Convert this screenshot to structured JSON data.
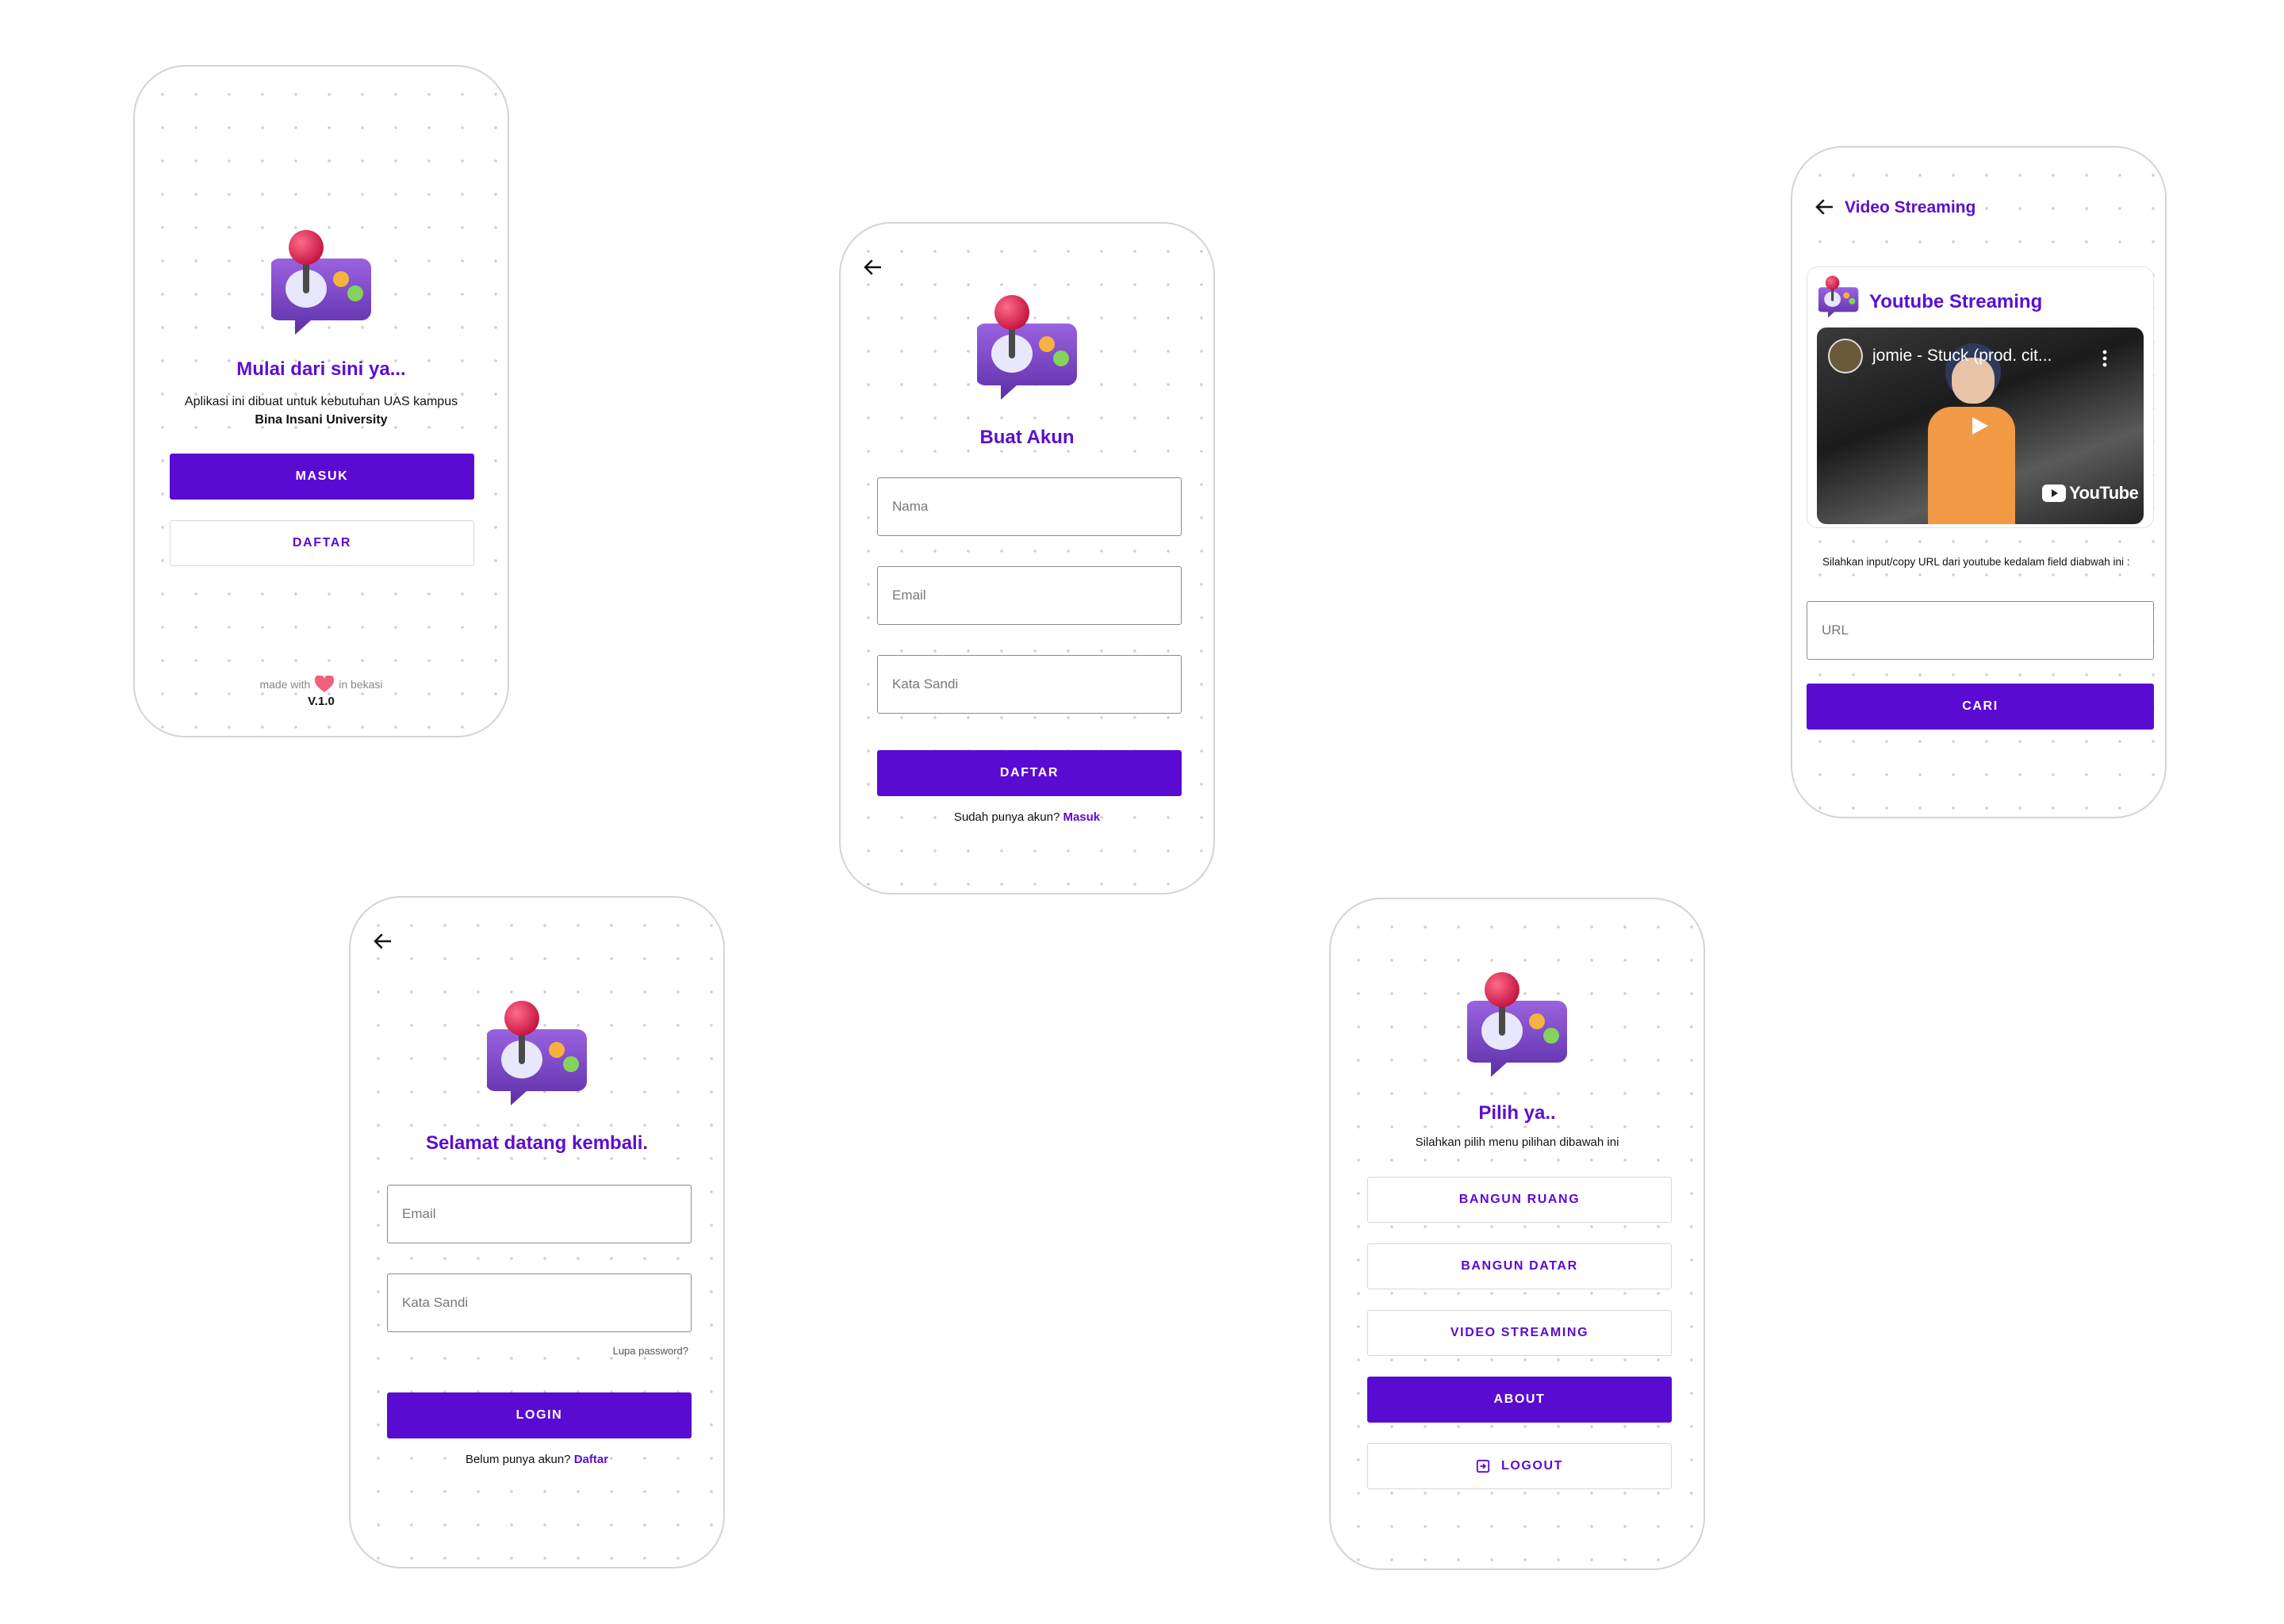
{
  "welcome": {
    "title": "Mulai dari sini ya...",
    "desc_line1": "Aplikasi ini dibuat untuk kebutuhan UAS kampus",
    "desc_line2": "Bina Insani University",
    "masuk_label": "MASUK",
    "daftar_label": "DAFTAR",
    "footer_made": "made with",
    "footer_in": "in bekasi",
    "version": "V.1.0"
  },
  "register": {
    "title": "Buat Akun",
    "name_placeholder": "Nama",
    "email_placeholder": "Email",
    "password_placeholder": "Kata Sandi",
    "submit_label": "DAFTAR",
    "have_account": "Sudah punya akun?",
    "login_link": "Masuk"
  },
  "video": {
    "header_title": "Video Streaming",
    "card_title": "Youtube Streaming",
    "video_title": "jomie - Stuck (prod. cit...",
    "youtube_brand": "YouTube",
    "instruction": "Silahkan input/copy URL dari youtube kedalam field diabwah ini :",
    "url_placeholder": "URL",
    "search_label": "CARI"
  },
  "login": {
    "title": "Selamat datang kembali.",
    "email_placeholder": "Email",
    "password_placeholder": "Kata Sandi",
    "forgot": "Lupa password?",
    "submit_label": "LOGIN",
    "no_account": "Belum punya akun?",
    "register_link": "Daftar"
  },
  "menu": {
    "title": "Pilih ya..",
    "subtitle": "Silahkan pilih menu pilihan dibawah ini",
    "items": [
      "BANGUN RUANG",
      "BANGUN DATAR",
      "VIDEO STREAMING",
      "ABOUT"
    ],
    "logout_label": "LOGOUT"
  },
  "colors": {
    "accent": "#5a0bd2",
    "logo_body": "#7b45c8",
    "joystick_ball": "#e8305f"
  },
  "icons": [
    "arrow-left-icon",
    "gamepad-logo-icon",
    "heart-icon",
    "play-icon",
    "more-vert-icon",
    "logout-icon"
  ]
}
